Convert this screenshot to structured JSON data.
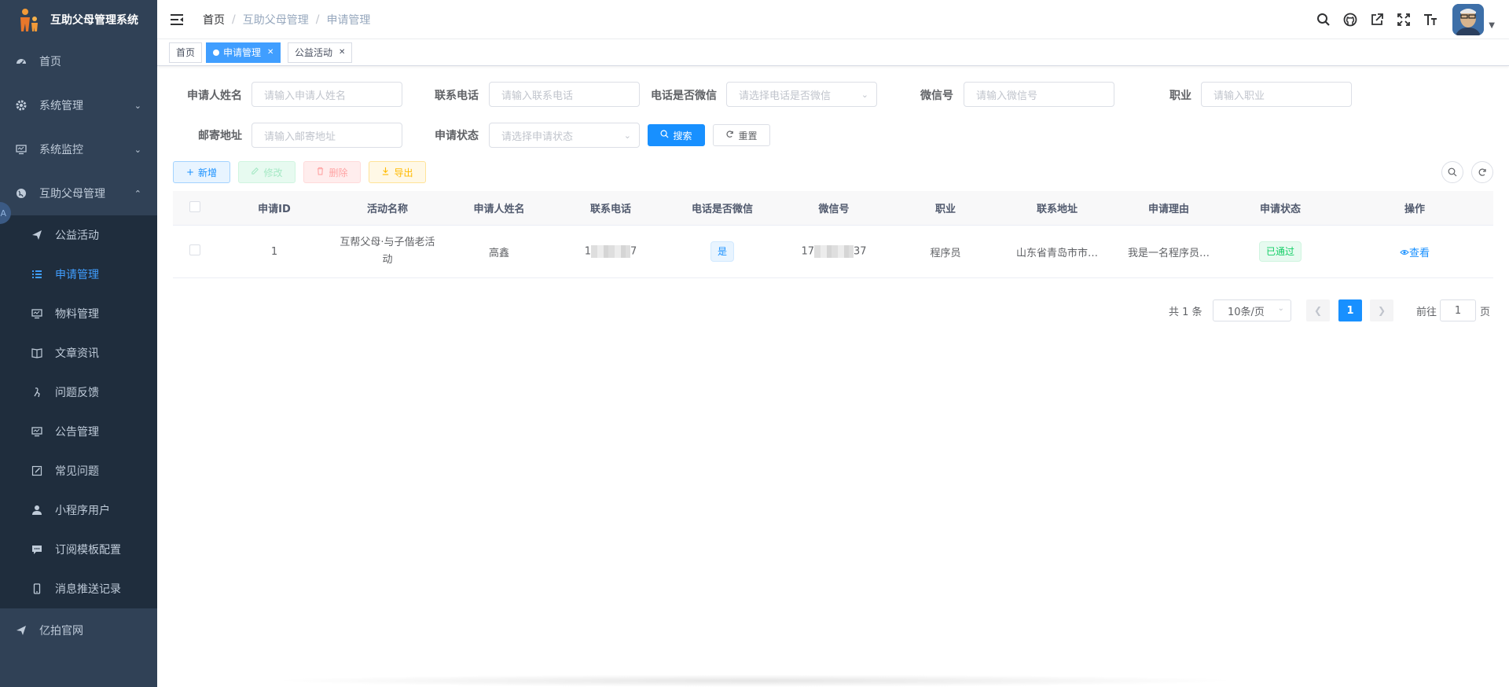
{
  "app": {
    "title": "互助父母管理系统"
  },
  "sidebar": {
    "items": [
      {
        "label": "首页",
        "icon": "dashboard-icon"
      },
      {
        "label": "系统管理",
        "icon": "gear-icon"
      },
      {
        "label": "系统监控",
        "icon": "monitor-icon"
      },
      {
        "label": "互助父母管理",
        "icon": "globe-icon"
      }
    ],
    "sub_items": [
      {
        "label": "公益活动",
        "icon": "send-icon"
      },
      {
        "label": "申请管理",
        "icon": "list-icon",
        "active": true
      },
      {
        "label": "物料管理",
        "icon": "monitor-icon"
      },
      {
        "label": "文章资讯",
        "icon": "book-icon"
      },
      {
        "label": "问题反馈",
        "icon": "guide-icon"
      },
      {
        "label": "公告管理",
        "icon": "monitor-icon"
      },
      {
        "label": "常见问题",
        "icon": "edit-icon"
      },
      {
        "label": "小程序用户",
        "icon": "user-icon"
      },
      {
        "label": "订阅模板配置",
        "icon": "message-icon"
      },
      {
        "label": "消息推送记录",
        "icon": "phone-icon"
      }
    ],
    "bottom_item": {
      "label": "亿拍官网",
      "icon": "send-icon"
    },
    "lang_badge": "A"
  },
  "navbar": {
    "breadcrumb": [
      "首页",
      "互助父母管理",
      "申请管理"
    ],
    "icons": [
      "search-icon",
      "github-icon",
      "external-link-icon",
      "fullscreen-icon",
      "font-size-icon"
    ]
  },
  "tags": [
    {
      "label": "首页",
      "active": false,
      "closable": false
    },
    {
      "label": "申请管理",
      "active": true,
      "closable": true
    },
    {
      "label": "公益活动",
      "active": false,
      "closable": true
    }
  ],
  "search_form": {
    "name": {
      "label": "申请人姓名",
      "placeholder": "请输入申请人姓名"
    },
    "phone": {
      "label": "联系电话",
      "placeholder": "请输入联系电话"
    },
    "is_wechat": {
      "label": "电话是否微信",
      "placeholder": "请选择电话是否微信"
    },
    "wechat": {
      "label": "微信号",
      "placeholder": "请输入微信号"
    },
    "job": {
      "label": "职业",
      "placeholder": "请输入职业"
    },
    "address": {
      "label": "邮寄地址",
      "placeholder": "请输入邮寄地址"
    },
    "status": {
      "label": "申请状态",
      "placeholder": "请选择申请状态"
    },
    "search_label": "搜索",
    "reset_label": "重置"
  },
  "toolbar": {
    "add_label": "新增",
    "edit_label": "修改",
    "delete_label": "删除",
    "export_label": "导出"
  },
  "table": {
    "columns": [
      "申请ID",
      "活动名称",
      "申请人姓名",
      "联系电话",
      "电话是否微信",
      "微信号",
      "职业",
      "联系地址",
      "申请理由",
      "申请状态",
      "操作"
    ],
    "rows": [
      {
        "id": "1",
        "activity": "互帮父母·与子偕老活动",
        "name": "高鑫",
        "phone_prefix": "1",
        "phone_suffix": "7",
        "is_wechat": "是",
        "wechat_prefix": "17",
        "wechat_suffix": "37",
        "job": "程序员",
        "address": "山东省青岛市市…",
        "reason": "我是一名程序员…",
        "status": "已通过",
        "action": "查看"
      }
    ]
  },
  "pagination": {
    "total_text": "共 1 条",
    "page_size": "10条/页",
    "current_page": "1",
    "jump_prefix": "前往",
    "jump_value": "1",
    "jump_suffix": "页"
  }
}
